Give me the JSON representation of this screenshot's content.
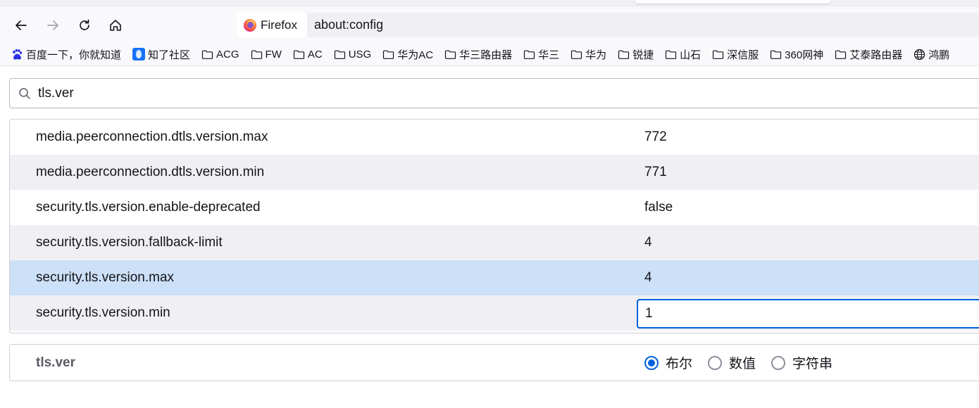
{
  "browser": {
    "identity_label": "Firefox",
    "url": "about:config"
  },
  "bookmarks": [
    {
      "label": "百度一下，你就知道",
      "icon": "baidu-icon"
    },
    {
      "label": "知了社区",
      "icon": "zhihu-icon"
    },
    {
      "label": "ACG",
      "icon": "folder-icon"
    },
    {
      "label": "FW",
      "icon": "folder-icon"
    },
    {
      "label": "AC",
      "icon": "folder-icon"
    },
    {
      "label": "USG",
      "icon": "folder-icon"
    },
    {
      "label": "华为AC",
      "icon": "folder-icon"
    },
    {
      "label": "华三路由器",
      "icon": "folder-icon"
    },
    {
      "label": "华三",
      "icon": "folder-icon"
    },
    {
      "label": "华为",
      "icon": "folder-icon"
    },
    {
      "label": "锐捷",
      "icon": "folder-icon"
    },
    {
      "label": "山石",
      "icon": "folder-icon"
    },
    {
      "label": "深信服",
      "icon": "folder-icon"
    },
    {
      "label": "360网神",
      "icon": "folder-icon"
    },
    {
      "label": "艾泰路由器",
      "icon": "folder-icon"
    },
    {
      "label": "鸿鹏",
      "icon": "globe-icon"
    }
  ],
  "search": {
    "value": "tls.ver"
  },
  "prefs": [
    {
      "name": "media.peerconnection.dtls.version.max",
      "value": "772"
    },
    {
      "name": "media.peerconnection.dtls.version.min",
      "value": "771"
    },
    {
      "name": "security.tls.version.enable-deprecated",
      "value": "false"
    },
    {
      "name": "security.tls.version.fallback-limit",
      "value": "4"
    },
    {
      "name": "security.tls.version.max",
      "value": "4"
    },
    {
      "name": "security.tls.version.min",
      "value": "1"
    }
  ],
  "new_pref": {
    "name": "tls.ver",
    "types": [
      {
        "label": "布尔",
        "checked": true
      },
      {
        "label": "数值",
        "checked": false
      },
      {
        "label": "字符串",
        "checked": false
      }
    ]
  },
  "colors": {
    "selected_row": "#cce0f7",
    "alt_row": "#f0f0f4",
    "accent": "#0061e0"
  }
}
